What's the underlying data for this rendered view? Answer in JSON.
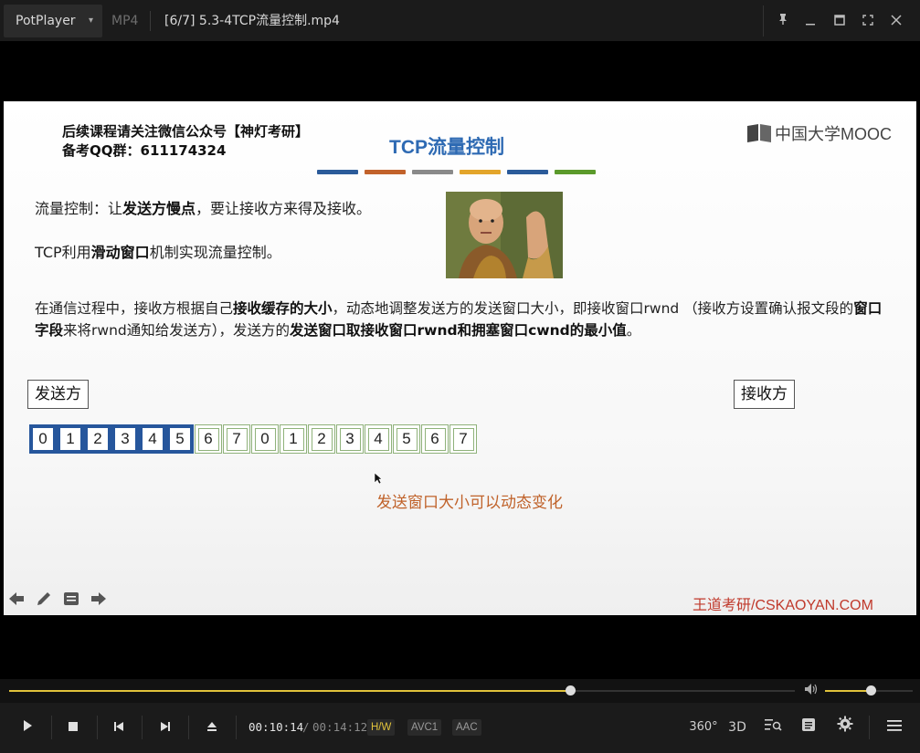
{
  "titlebar": {
    "app_name": "PotPlayer",
    "format": "MP4",
    "file_title": "[6/7] 5.3-4TCP流量控制.mp4",
    "icons": [
      "pin-icon",
      "minimize-icon",
      "maximize-icon",
      "fullscreen-icon",
      "close-icon"
    ]
  },
  "slide": {
    "promo_line1": "后续课程请关注微信公众号【神灯考研】",
    "promo_line2": "备考QQ群：611174324",
    "title": "TCP流量控制",
    "brand": "中国大学MOOC",
    "title_bar_colors": [
      "#2b5b9a",
      "#c2622b",
      "#8a8a8a",
      "#e3a52b",
      "#2b5b9a",
      "#5b9a2b"
    ],
    "line1_pre": "流量控制：让",
    "line1_bold": "发送方慢点",
    "line1_post": "，要让接收方来得及接收。",
    "line2_pre": "TCP利用",
    "line2_bold": "滑动窗口",
    "line2_post": "机制实现流量控制。",
    "para_a": "在通信过程中，接收方根据自己",
    "para_b": "接收缓存的大小",
    "para_c": "，动态地调整发送方的发送窗口大小，即接收窗口rwnd （接收方设置确认报文段的",
    "para_d": "窗口字段",
    "para_e": "来将rwnd通知给发送方），发送方的",
    "para_f": "发送窗口取接收窗口rwnd和拥塞窗口cwnd的最小值",
    "para_g": "。",
    "sender_label": "发送方",
    "receiver_label": "接收方",
    "window_cells": [
      "0",
      "1",
      "2",
      "3",
      "4",
      "5",
      "6",
      "7",
      "0",
      "1",
      "2",
      "3",
      "4",
      "5",
      "6",
      "7"
    ],
    "window_size": 6,
    "caption": "发送窗口大小可以动态变化",
    "watermark": "王道考研/CSKAOYAN.COM"
  },
  "playback": {
    "progress_fraction": 0.714,
    "volume_fraction": 0.52,
    "elapsed": "00:10:14",
    "time_sep": "/",
    "total": "00:14:12",
    "tag_hw": "H/W",
    "tag_video": "AVC1",
    "tag_audio": "AAC",
    "btn_360": "360°",
    "btn_3d": "3D"
  }
}
